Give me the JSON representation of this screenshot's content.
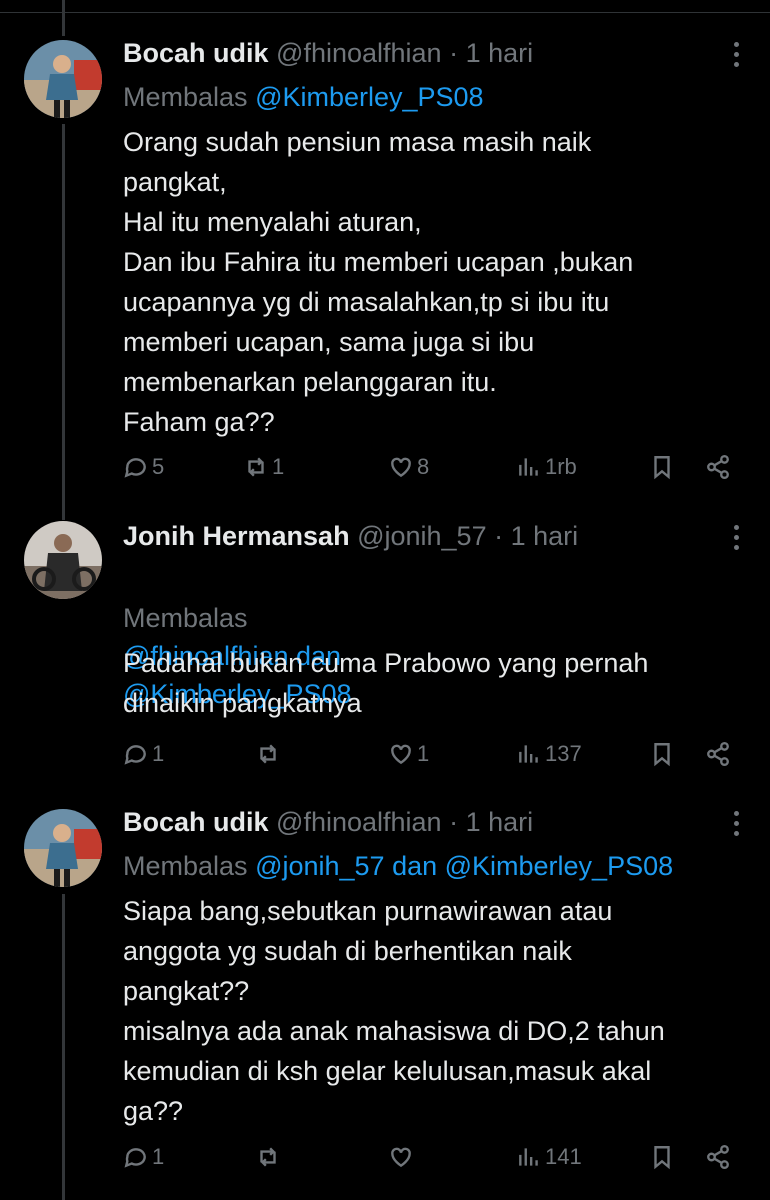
{
  "tweets": [
    {
      "name": "Bocah udik",
      "handle": "@fhinoalfhian",
      "time": "1 hari",
      "reply_prefix": "Membalas",
      "reply_mentions": "@Kimberley_PS08",
      "text": "Orang sudah pensiun masa masih naik\npangkat,\nHal itu menyalahi aturan,\nDan ibu Fahira itu memberi ucapan ,bukan\nucapannya yg di masalahkan,tp si ibu itu\nmemberi ucapan, sama juga si ibu\nmembenarkan pelanggaran itu.\nFaham ga??",
      "replies": "5",
      "reposts": "1",
      "likes": "8",
      "views": "1rb"
    },
    {
      "name": "Jonih Hermansah",
      "handle": "@jonih_57",
      "time": "1 hari",
      "reply_prefix": "Membalas",
      "reply_mentions": "@fhinoalfhian dan\n@Kimberley_PS08",
      "text": "Padahal bukan cuma Prabowo yang pernah\ndinaikin pangkatnya",
      "replies": "1",
      "reposts": "",
      "likes": "1",
      "views": "137"
    },
    {
      "name": "Bocah udik",
      "handle": "@fhinoalfhian",
      "time": "1 hari",
      "reply_prefix": "Membalas",
      "reply_mentions": "@jonih_57 dan @Kimberley_PS08",
      "text": "Siapa bang,sebutkan purnawirawan atau\nanggota yg sudah di berhentikan naik\npangkat??\nmisalnya ada anak mahasiswa di DO,2 tahun\nkemudian di ksh gelar kelulusan,masuk akal\nga??",
      "replies": "1",
      "reposts": "",
      "likes": "",
      "views": "141"
    }
  ],
  "separator": "·",
  "icons": [
    "reply-icon",
    "repost-icon",
    "like-icon",
    "views-icon",
    "bookmark-icon",
    "share-icon",
    "more-icon"
  ],
  "colors": {
    "background": "#000000",
    "text": "#e7e9ea",
    "muted": "#71767b",
    "accent": "#1d9bf0"
  }
}
